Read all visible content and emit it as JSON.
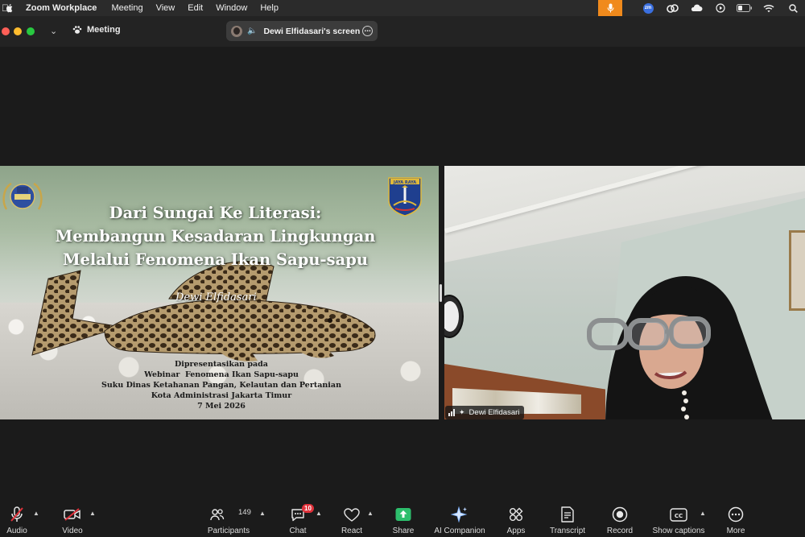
{
  "menubar": {
    "app_name": "Zoom Workplace",
    "menus": [
      "Meeting",
      "View",
      "Edit",
      "Window",
      "Help"
    ],
    "tray_zm": "zm"
  },
  "titlebar": {
    "meeting_label": "Meeting",
    "share_label": "Dewi Elfidasari's screen"
  },
  "slide": {
    "title_lines": [
      "Dari Sungai Ke Literasi:",
      "Membangun Kesadaran Lingkungan",
      "Melalui Fenomena Ikan Sapu-sapu"
    ],
    "presenter": "Dewi Elfidasari",
    "logo_right_text": "JAYA RAYA",
    "info_lines": [
      "Dipresentasikan pada",
      "Webinar  Fenomena Ikan Sapu-sapu",
      "Suku Dinas Ketahanan Pangan, Kelautan dan Pertanian",
      "Kota Administrasi Jakarta Timur",
      "7 Mei 2026"
    ]
  },
  "camera": {
    "participant_name": "Dewi Elfidasari"
  },
  "toolbar": {
    "audio": "Audio",
    "video": "Video",
    "participants": "Participants",
    "participants_count": "149",
    "chat": "Chat",
    "chat_badge": "10",
    "react": "React",
    "share": "Share",
    "ai_companion": "AI Companion",
    "apps": "Apps",
    "transcript": "Transcript",
    "record": "Record",
    "show_captions": "Show captions",
    "more": "More"
  },
  "colors": {
    "mic_status": "#f08a1c",
    "share_green": "#2dbe6c",
    "chat_badge": "#e0313a"
  }
}
